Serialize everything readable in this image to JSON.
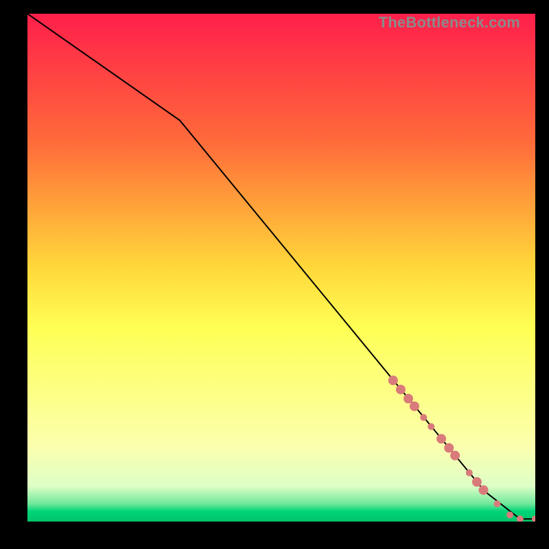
{
  "watermark": "TheBottleneck.com",
  "chart_data": {
    "type": "line",
    "title": "",
    "xlabel": "",
    "ylabel": "",
    "xlim": [
      0,
      100
    ],
    "ylim": [
      0,
      100
    ],
    "gradient_stops": [
      {
        "offset": 0.0,
        "color": "#ff1f4b"
      },
      {
        "offset": 0.25,
        "color": "#ff6a3a"
      },
      {
        "offset": 0.5,
        "color": "#ffd83a"
      },
      {
        "offset": 0.62,
        "color": "#ffff55"
      },
      {
        "offset": 0.85,
        "color": "#fbffad"
      },
      {
        "offset": 0.93,
        "color": "#dfffc6"
      },
      {
        "offset": 0.965,
        "color": "#6fe89b"
      },
      {
        "offset": 0.98,
        "color": "#00d477"
      },
      {
        "offset": 1.0,
        "color": "#00c46b"
      }
    ],
    "series": [
      {
        "name": "bottleneck-curve",
        "type": "line",
        "color": "#000000",
        "width": 2,
        "x": [
          0,
          30,
          90,
          97,
          100
        ],
        "y": [
          100,
          79,
          6,
          0.5,
          0.5
        ]
      },
      {
        "name": "highlight-points",
        "type": "scatter",
        "color": "#d97b7b",
        "radius_small": 5,
        "radius_large": 7,
        "points": [
          {
            "x": 72.0,
            "y": 27.8,
            "r": "large"
          },
          {
            "x": 73.5,
            "y": 26.0,
            "r": "large"
          },
          {
            "x": 75.0,
            "y": 24.2,
            "r": "large"
          },
          {
            "x": 76.2,
            "y": 22.7,
            "r": "large"
          },
          {
            "x": 78.0,
            "y": 20.5,
            "r": "small"
          },
          {
            "x": 79.5,
            "y": 18.7,
            "r": "small"
          },
          {
            "x": 81.5,
            "y": 16.3,
            "r": "large"
          },
          {
            "x": 83.0,
            "y": 14.5,
            "r": "large"
          },
          {
            "x": 84.2,
            "y": 13.0,
            "r": "large"
          },
          {
            "x": 87.0,
            "y": 9.6,
            "r": "small"
          },
          {
            "x": 88.5,
            "y": 7.8,
            "r": "large"
          },
          {
            "x": 89.8,
            "y": 6.2,
            "r": "large"
          },
          {
            "x": 92.5,
            "y": 3.5,
            "r": "small"
          },
          {
            "x": 95.0,
            "y": 1.3,
            "r": "small"
          },
          {
            "x": 97.0,
            "y": 0.5,
            "r": "small"
          },
          {
            "x": 100.0,
            "y": 0.5,
            "r": "small"
          }
        ]
      }
    ]
  }
}
